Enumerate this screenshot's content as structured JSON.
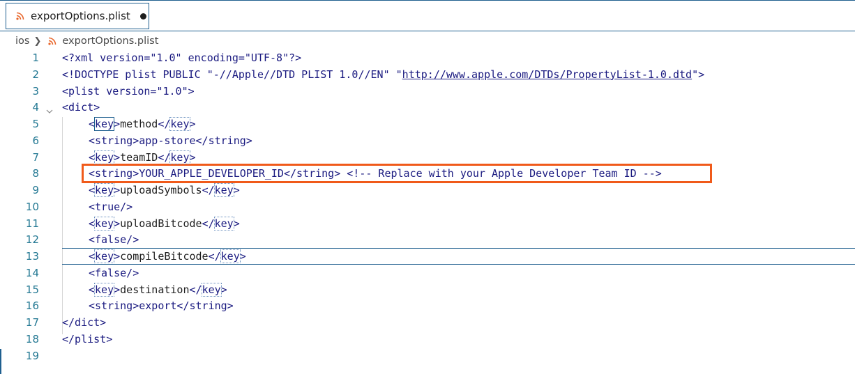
{
  "tab": {
    "label": "exportOptions.plist",
    "icon": "rss-icon"
  },
  "breadcrumb": {
    "folder": "ios",
    "file": "exportOptions.plist"
  },
  "lines": [
    {
      "n": "1",
      "code": "<?xml version=\"1.0\" encoding=\"UTF-8\"?>"
    },
    {
      "n": "2",
      "pre": "<!DOCTYPE plist PUBLIC \"-//Apple//DTD PLIST 1.0//EN\" \"",
      "url": "http://www.apple.com/DTDs/PropertyList-1.0.dtd",
      "post": "\">"
    },
    {
      "n": "3",
      "code": "<plist version=\"1.0\">"
    },
    {
      "n": "4",
      "code": "<dict>"
    },
    {
      "n": "5",
      "tag": "key",
      "value": "method"
    },
    {
      "n": "6",
      "code": "<string>app-store</string>"
    },
    {
      "n": "7",
      "tag": "key",
      "value": "teamID"
    },
    {
      "n": "8",
      "code": "<string>YOUR_APPLE_DEVELOPER_ID</string> <!-- Replace with your Apple Developer Team ID -->"
    },
    {
      "n": "9",
      "tag": "key",
      "value": "uploadSymbols"
    },
    {
      "n": "10",
      "code": "<true/>"
    },
    {
      "n": "11",
      "tag": "key",
      "value": "uploadBitcode"
    },
    {
      "n": "12",
      "code": "<false/>"
    },
    {
      "n": "13",
      "tag": "key",
      "value": "compileBitcode"
    },
    {
      "n": "14",
      "code": "<false/>"
    },
    {
      "n": "15",
      "tag": "key",
      "value": "destination"
    },
    {
      "n": "16",
      "code": "<string>export</string>"
    },
    {
      "n": "17",
      "code": "</dict>"
    },
    {
      "n": "18",
      "code": "</plist>"
    },
    {
      "n": "19",
      "code": ""
    }
  ],
  "colors": {
    "accent": "#1f5f8f",
    "highlight_box": "#f05a1a",
    "line_number": "#237893"
  }
}
